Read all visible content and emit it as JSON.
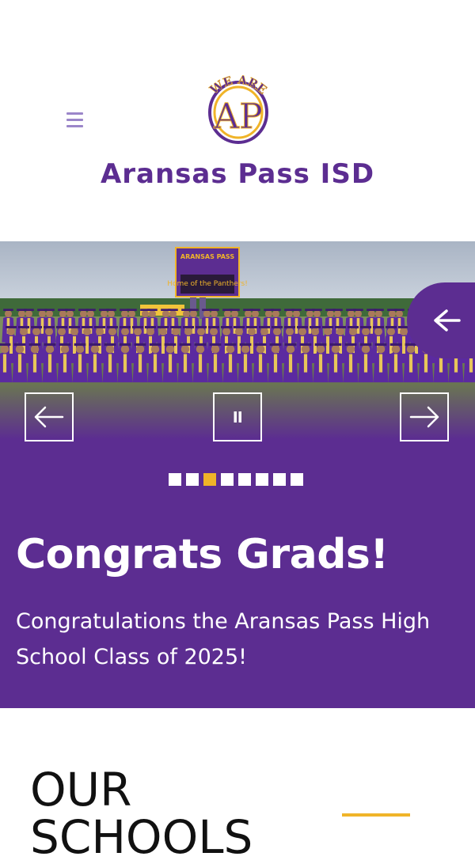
{
  "header": {
    "logo_text_top": "WE ARE",
    "logo_monogram": "AP",
    "site_title": "Aransas Pass ISD",
    "menu_icon": "hamburger-icon"
  },
  "slideshow": {
    "photo_sign_top": "ARANSAS PASS",
    "photo_sign_message": "Home of the Panthers!",
    "slide_title": "Congrats Grads!",
    "slide_description": "Congratulations the Aransas Pass High School Class of 2025!",
    "total_slides": 8,
    "active_slide": 3,
    "controls": {
      "prev_icon": "arrow-left-icon",
      "pause_icon": "pause-icon",
      "next_icon": "arrow-right-icon",
      "side_tab_icon": "arrow-left-icon"
    }
  },
  "schools": {
    "heading": "OUR SCHOOLS"
  },
  "colors": {
    "brand_purple": "#5c2d91",
    "accent_gold": "#f0b429",
    "menu_lavender": "#9b86c9"
  }
}
